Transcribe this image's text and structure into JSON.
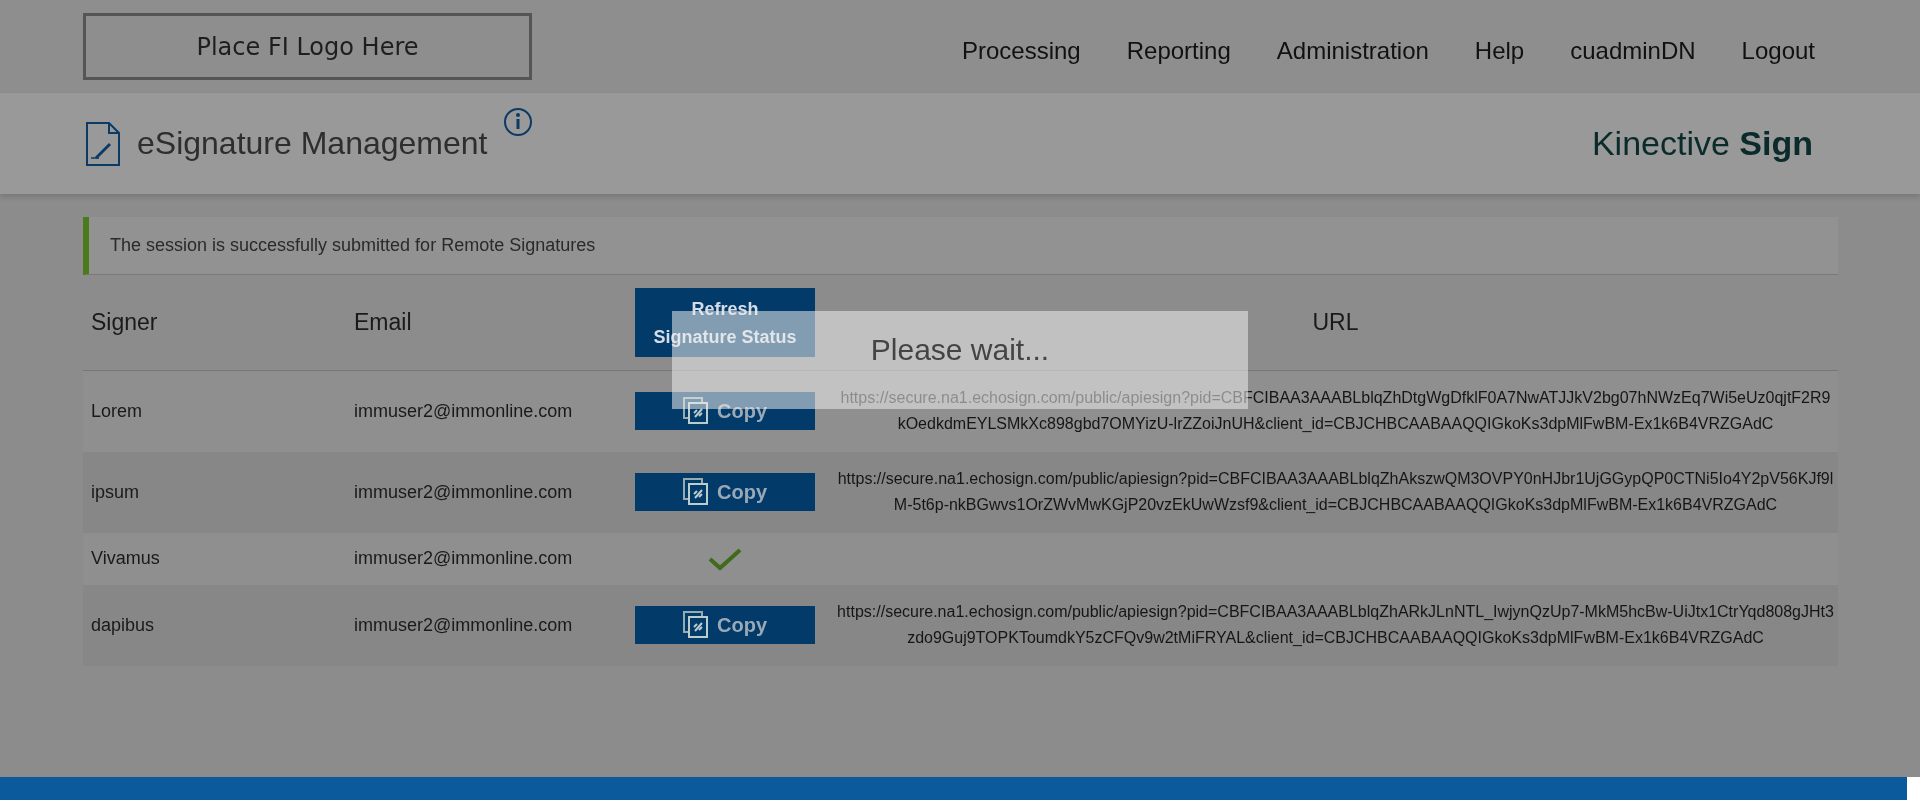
{
  "header": {
    "logo": "Place FI Logo Here",
    "nav": [
      "Processing",
      "Reporting",
      "Administration",
      "Help",
      "cuadminDN",
      "Logout"
    ]
  },
  "subheader": {
    "title": "eSignature Management",
    "brand": "Kinective **Sign**"
  },
  "message": "The session is successfully submitted for Remote Signatures",
  "table": {
    "columns": [
      "Signer",
      "Email",
      "Refresh Signature Status",
      "URL"
    ],
    "rows": [
      {
        "signer": "Lorem",
        "email": "immuser2@immonline.com",
        "action": {
          "kind": "copy",
          "label": "Copy"
        },
        "url": "https://secure.na1.echosign.com/public/apiesign?pid=CBFCIBAA3AAABLblqZhDtgWgDfklF0A7NwATJJkV2bg07hNWzEq7Wi5eUz0qjtF2R9kOedkdmEYLSMkXc898gbd7OMYizU-lrZZoiJnUH&client_id=CBJCHBCAABAAQQIGkoKs3dpMlFwBM-Ex1k6B4VRZGAdC"
      },
      {
        "signer": "ipsum",
        "email": "immuser2@immonline.com",
        "action": {
          "kind": "copy",
          "label": "Copy"
        },
        "url": "https://secure.na1.echosign.com/public/apiesign?pid=CBFCIBAA3AAABLblqZhAkszwQM3OVPY0nHJbr1UjGGypQP0CTNi5Io4Y2pV56KJf9lM-5t6p-nkBGwvs1OrZWvMwKGjP20vzEkUwWzsf9&client_id=CBJCHBCAABAAQQIGkoKs3dpMlFwBM-Ex1k6B4VRZGAdC"
      },
      {
        "signer": "Vivamus",
        "email": "immuser2@immonline.com",
        "action": {
          "kind": "signed"
        }
      },
      {
        "signer": "dapibus",
        "email": "immuser2@immonline.com",
        "action": {
          "kind": "copy",
          "label": "Copy"
        },
        "url": "https://secure.na1.echosign.com/public/apiesign?pid=CBFCIBAA3AAABLblqZhARkJLnNTL_IwjynQzUp7-MkM5hcBw-UiJtx1CtrYqd808gJHt3zdo9Guj9TOPKToumdkY5zCFQv9w2tMiFRYAL&client_id=CBJCHBCAABAAQQIGkoKs3dpMlFwBM-Ex1k6B4VRZGAdC"
      }
    ]
  },
  "loading": {
    "text": "Please wait..."
  }
}
